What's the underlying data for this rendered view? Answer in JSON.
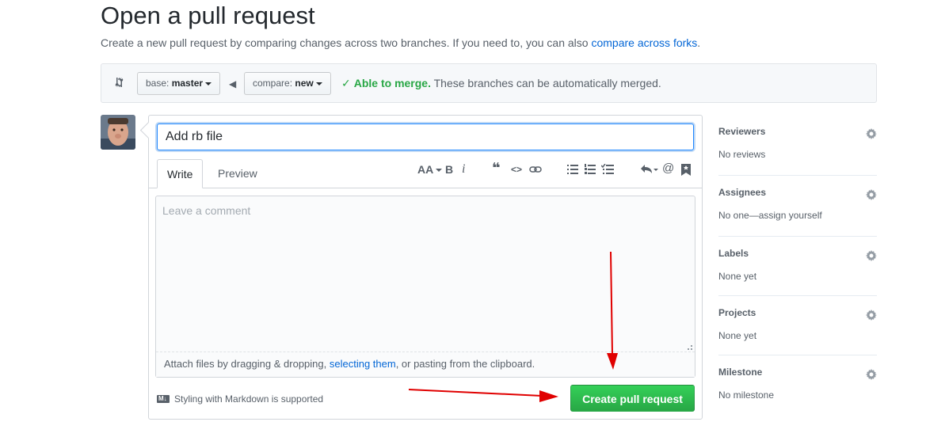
{
  "page": {
    "title": "Open a pull request",
    "subtitle_text": "Create a new pull request by comparing changes across two branches. If you need to, you can also ",
    "subtitle_link": "compare across forks",
    "subtitle_end": "."
  },
  "range": {
    "base_prefix": "base:",
    "base_branch": "master",
    "compare_prefix": "compare:",
    "compare_branch": "new",
    "merge_ok": "Able to merge.",
    "merge_msg": "These branches can be automatically merged."
  },
  "editor": {
    "title_value": "Add rb file",
    "tab_write": "Write",
    "tab_preview": "Preview",
    "toolbar_header": "AA",
    "toolbar_bold": "B",
    "toolbar_italic": "i",
    "toolbar_quote": "❝",
    "toolbar_code": "<>",
    "toolbar_mention": "@",
    "comment_placeholder": "Leave a comment",
    "attach_text_pre": "Attach files by dragging & dropping, ",
    "attach_link": "selecting them",
    "attach_text_post": ", or pasting from the clipboard.",
    "markdown_note": "Styling with Markdown is supported",
    "create_button": "Create pull request"
  },
  "sidebar": {
    "reviewers_label": "Reviewers",
    "reviewers_value": "No reviews",
    "assignees_label": "Assignees",
    "assignees_value": "No one—assign yourself",
    "labels_label": "Labels",
    "labels_value": "None yet",
    "projects_label": "Projects",
    "projects_value": "None yet",
    "milestone_label": "Milestone",
    "milestone_value": "No milestone"
  },
  "colors": {
    "accent_link": "#0366d6",
    "merge_green": "#28a745",
    "annotation_red": "#e00000"
  },
  "icons": [
    "git-compare-icon",
    "arrow-left-icon",
    "check-icon",
    "header-icon",
    "bold-icon",
    "italic-icon",
    "quote-icon",
    "code-icon",
    "link-icon",
    "unordered-list-icon",
    "ordered-list-icon",
    "task-list-icon",
    "reply-icon",
    "mention-icon",
    "bookmark-icon",
    "markdown-icon",
    "gear-icon"
  ]
}
